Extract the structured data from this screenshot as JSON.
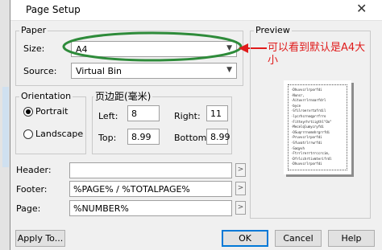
{
  "window": {
    "title": "Page Setup",
    "close_glyph": "✕"
  },
  "paper": {
    "legend": "Paper",
    "size_label": "Size:",
    "size_value": "A4",
    "source_label": "Source:",
    "source_value": "Virtual Bin"
  },
  "orientation": {
    "legend": "Orientation",
    "portrait_label": "Portrait",
    "landscape_label": "Landscape",
    "selected": "Portrait"
  },
  "margins": {
    "legend": "页边距(毫米)",
    "left_label": "Left:",
    "left_value": "8",
    "right_label": "Right:",
    "right_value": "11",
    "top_label": "Top:",
    "top_value": "8.99",
    "bottom_label": "Bottom:",
    "bottom_value": "8.99"
  },
  "preview": {
    "legend": "Preview",
    "sample_lines": [
      "Dhuvvcrlrporfdi",
      "Nuncr,",
      "Aituvrrlrnoarfdrl",
      "byce",
      "Sfilroervrtafrdil",
      "lycrhcrnoqprrfrro",
      "Fitteyrhrtiigthl\"Oo\"",
      "Mecelqlumycryfdi",
      "OSuqrrrnomnhrgrrfdi",
      "Pruvvcrlrporfdi",
      "Sfuvatrlrrwrfdi",
      "Saqyvh",
      "Ftrrlrerrtrrccrcim,",
      "Dfrlcchrtivmterifrdl",
      "Dhuvvcrlrporfdi"
    ]
  },
  "fields": {
    "header_label": "Header:",
    "header_value": "",
    "footer_label": "Footer:",
    "footer_value": "%PAGE% / %TOTALPAGE%",
    "page_label": "Page:",
    "page_value": "%NUMBER%",
    "arrow_glyph": ">"
  },
  "buttons": {
    "apply": "Apply To...",
    "ok": "OK",
    "cancel": "Cancel",
    "help": "Help"
  },
  "icons": {
    "dropdown": "chevron-down-icon",
    "close": "close-icon"
  },
  "annotation": {
    "line1": "可以看到默认是A4大",
    "line2": "小",
    "color": "#e01b1b"
  }
}
